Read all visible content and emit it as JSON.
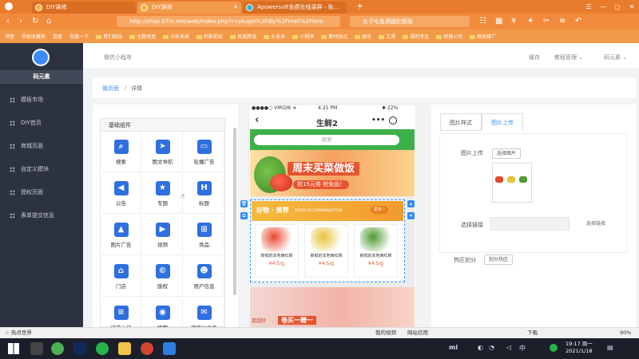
{
  "browser": {
    "tabs": [
      {
        "label": "DIY装修",
        "active": false
      },
      {
        "label": "DIY装修",
        "active": true
      },
      {
        "label": "Apowersoft免费在线录屏 - 免...",
        "active": false
      }
    ],
    "new_tab": "+",
    "window_controls": [
      "☰",
      "—",
      "▢",
      "✕"
    ],
    "url": "http://shop.07m.net/web/index.php?r=plugin%2Fdiy%2Fmall%2Ftem",
    "search_text": "女子吃鱼遇腿肚膨胀",
    "bookmarks": [
      "书签",
      "手机收藏夹",
      "百度",
      "百度一下",
      "哥们网站",
      "主题项目",
      "分析系统",
      "阿斯彩虹",
      "百度爬虫",
      "头条系",
      "小程序",
      "素材站点",
      "娱乐",
      "工具",
      "福利专区",
      "转推公司",
      "网易推广"
    ]
  },
  "sidebar": {
    "brand": "码元素",
    "items": [
      "模板市场",
      "DIY首页",
      "商城页面",
      "自定义模块",
      "授权页面",
      "表单提交信息"
    ]
  },
  "topbar": {
    "app_name": "微信小程序",
    "links": [
      "缓存",
      "教程管理 ⌄",
      "码元素 ⌄"
    ]
  },
  "breadcrumb": {
    "parent": "微页面",
    "separator": "/",
    "current": "详情"
  },
  "widgets": {
    "section_title": "基础组件",
    "items": [
      {
        "label": "搜索",
        "icon": "search-icon",
        "glyph": "⌕"
      },
      {
        "label": "图文导航",
        "icon": "navigation-icon",
        "glyph": "➤"
      },
      {
        "label": "轮播广告",
        "icon": "carousel-icon",
        "glyph": "▭"
      },
      {
        "label": "公告",
        "icon": "megaphone-icon",
        "glyph": "◀"
      },
      {
        "label": "专题",
        "icon": "topic-icon",
        "glyph": "★"
      },
      {
        "label": "标题",
        "icon": "heading-icon",
        "glyph": "H"
      },
      {
        "label": "图片广告",
        "icon": "image-icon",
        "glyph": "▲"
      },
      {
        "label": "视频",
        "icon": "video-icon",
        "glyph": "▶"
      },
      {
        "label": "商品",
        "icon": "basket-icon",
        "glyph": "⊞"
      },
      {
        "label": "门店",
        "icon": "store-icon",
        "glyph": "⌂"
      },
      {
        "label": "版权",
        "icon": "copyright-icon",
        "glyph": "©"
      },
      {
        "label": "用户信息",
        "icon": "user-icon",
        "glyph": "☻"
      },
      {
        "label": "订单入口",
        "icon": "order-icon",
        "glyph": "≡"
      },
      {
        "label": "地图",
        "icon": "map-pin-icon",
        "glyph": "◉"
      },
      {
        "label": "微信公众号",
        "icon": "wechat-icon",
        "glyph": "✉"
      }
    ]
  },
  "phone": {
    "carrier": "●●●●○ VIRGIN ᯤ",
    "time": "4:21 PM",
    "battery": "✱ 22%",
    "title": "生鲜2",
    "search_placeholder": "搜索",
    "banner_title": "周末买菜做饭",
    "banner_sub": "抢15元券 抢免运！",
    "rec_title": "好物 · 推荐",
    "rec_sub": "GOOD RECOMMENDATION",
    "rec_more": "更多 ›",
    "products": [
      {
        "name": "新鲜的本地西红柿",
        "price": "¥4.5/g",
        "color": "#e8492f"
      },
      {
        "name": "新鲜的本地西红柿",
        "price": "¥4.5/g",
        "color": "#e8c23a"
      },
      {
        "name": "新鲜的本地西红柿",
        "price": "¥4.5/g",
        "color": "#4f9a33"
      }
    ],
    "banner2_left": "鼠超好",
    "banner2_text": "卷买一赠一"
  },
  "settings": {
    "tabs": [
      "图片样式",
      "图片上传"
    ],
    "upload_label": "图片上传",
    "select_image_btn": "选择图片",
    "link_label": "选择链接",
    "link_btn": "选择链接",
    "hotzone_label": "热区划分",
    "hotzone_btn": "划分热区"
  },
  "browser_status": {
    "left": "☆ 热点世界",
    "items": [
      "我的视频",
      "网站信用",
      "下载",
      "90%"
    ]
  },
  "taskbar": {
    "time": "19:17 周一",
    "date": "2021/1/18",
    "ime": "中"
  }
}
